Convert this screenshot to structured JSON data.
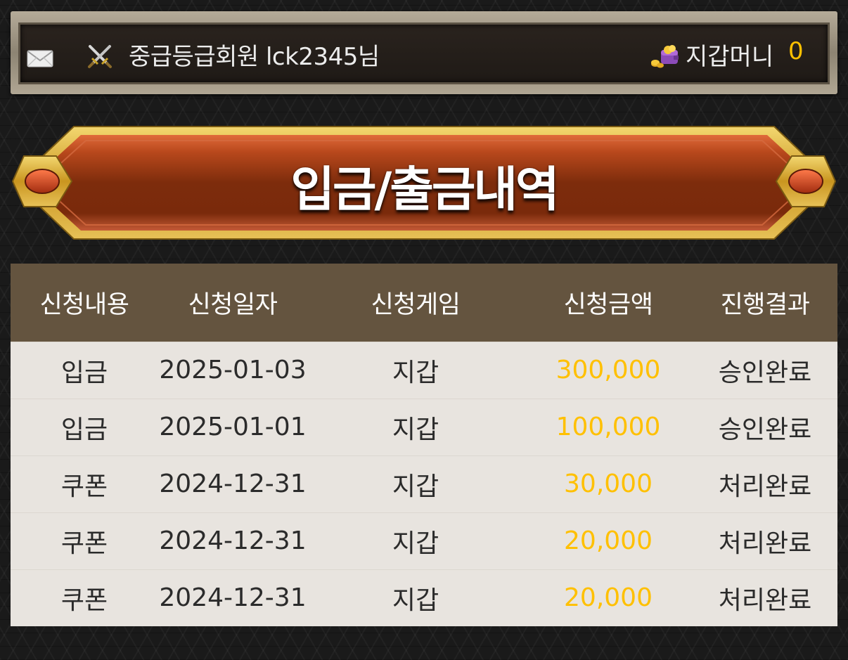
{
  "header": {
    "user_text": "중급등급회원 lck2345님",
    "wallet_label": "지갑머니",
    "wallet_amount": "0",
    "icons": [
      "mail-icon",
      "crossed-swords-icon",
      "wallet-coins-icon"
    ]
  },
  "title": "입금/출금내역",
  "table": {
    "columns": [
      "신청내용",
      "신청일자",
      "신청게임",
      "신청금액",
      "진행결과"
    ],
    "rows": [
      [
        "입금",
        "2025-01-03",
        "지갑",
        "300,000",
        "승인완료"
      ],
      [
        "입금",
        "2025-01-01",
        "지갑",
        "100,000",
        "승인완료"
      ],
      [
        "쿠폰",
        "2024-12-31",
        "지갑",
        "30,000",
        "처리완료"
      ],
      [
        "쿠폰",
        "2024-12-31",
        "지갑",
        "20,000",
        "처리완료"
      ],
      [
        "쿠폰",
        "2024-12-31",
        "지갑",
        "20,000",
        "처리완료"
      ]
    ]
  },
  "colors": {
    "accent_amount": "#ffc000",
    "table_header_bg": "#64543f",
    "table_row_bg": "#e8e4df",
    "banner_fill": "#7a2c0c",
    "banner_frame": "#d4a52c"
  }
}
